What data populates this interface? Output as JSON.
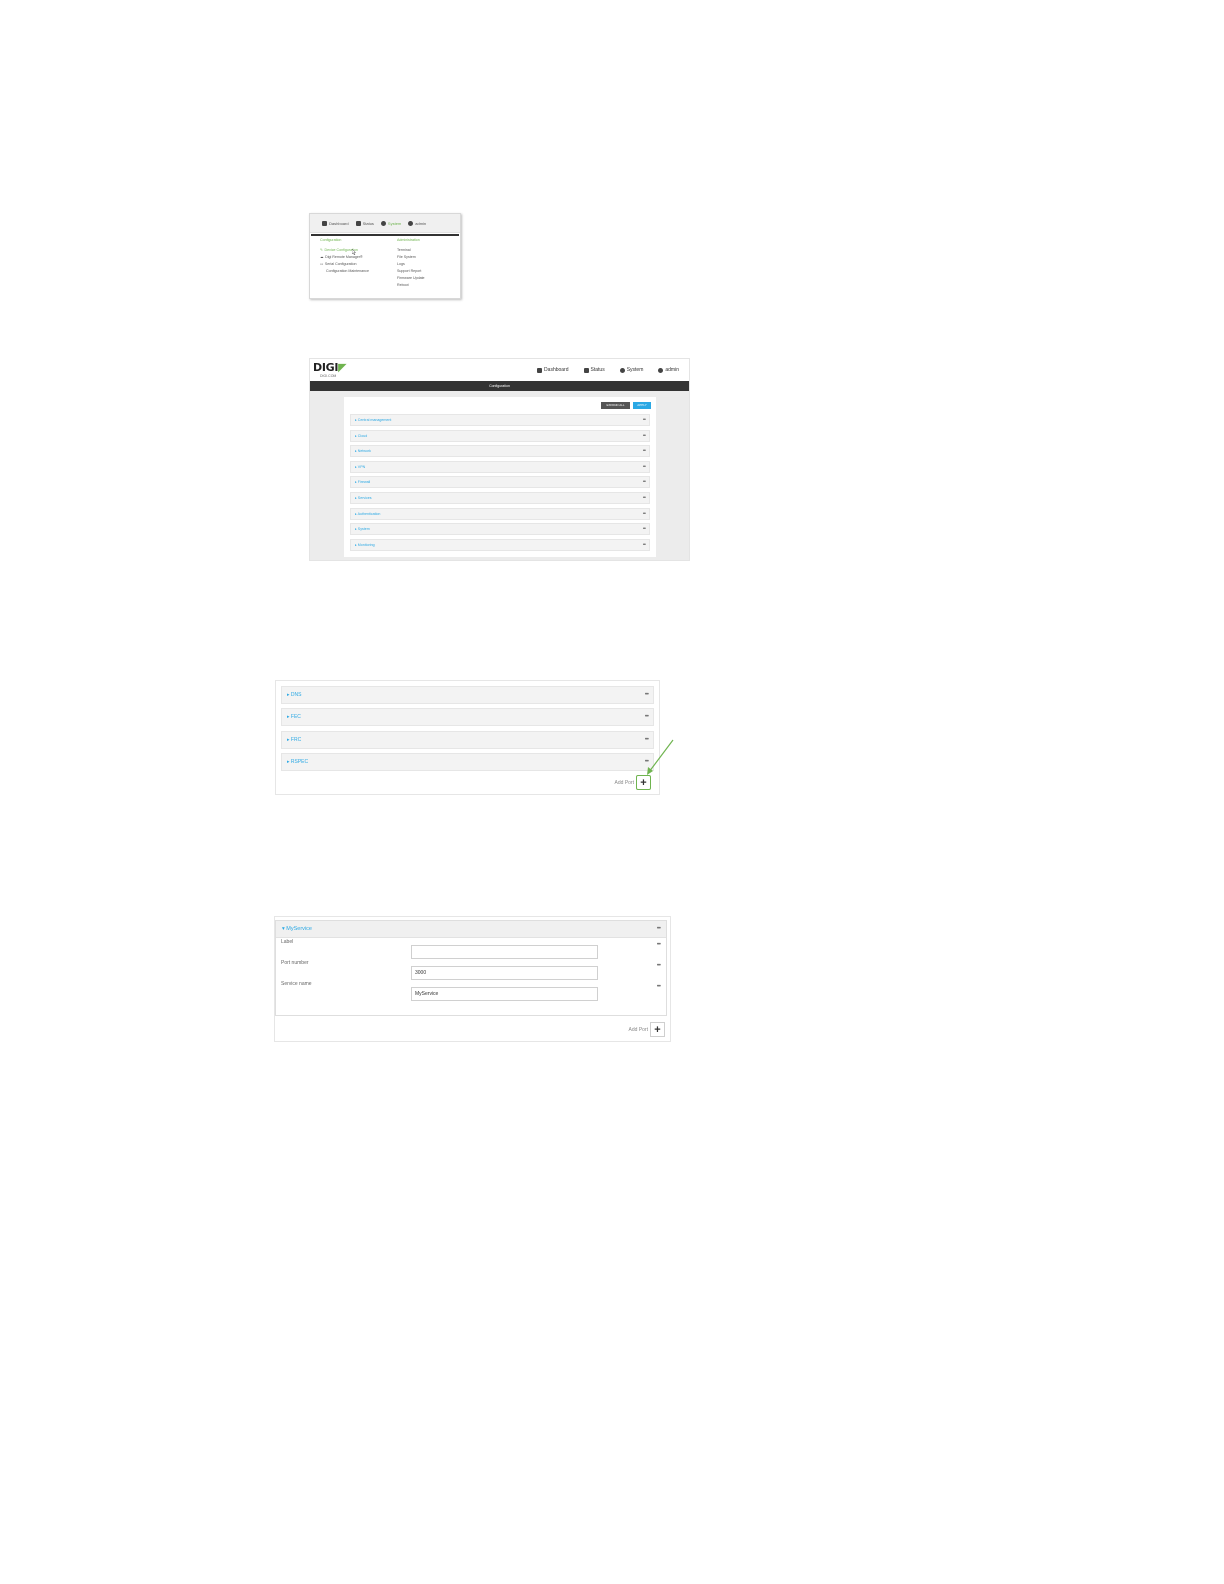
{
  "menu_shot": {
    "nav": [
      {
        "label": "Dashboard",
        "icon": "dashboard-icon"
      },
      {
        "label": "Status",
        "icon": "grid-icon"
      },
      {
        "label": "System",
        "icon": "gear-icon"
      },
      {
        "label": "admin",
        "icon": "user-icon"
      }
    ],
    "configuration_heading": "Configuration",
    "configuration_items": [
      "Device Configuration",
      "Digi Remote Manager®",
      "Serial Configuration",
      "Configuration Maintenance"
    ],
    "administration_heading": "Administration",
    "administration_items": [
      "Terminal",
      "File System",
      "Logs",
      "Support Report",
      "Firmware Update",
      "Reboot"
    ],
    "accent_color": "#6fb44f"
  },
  "config_shot": {
    "logo": "DIGI",
    "logo_sub": "DIGI.COM",
    "nav": [
      {
        "label": "Dashboard",
        "icon": "dashboard-icon"
      },
      {
        "label": "Status",
        "icon": "grid-icon"
      },
      {
        "label": "System",
        "icon": "gear-icon"
      },
      {
        "label": "admin",
        "icon": "user-icon"
      }
    ],
    "title_bar": "Configuration",
    "expand_all": "EXPAND ALL",
    "apply": "APPLY",
    "sections": [
      "Central management",
      "Cloud",
      "Network",
      "VPN",
      "Firewall",
      "Services",
      "Authentication",
      "System",
      "Monitoring"
    ],
    "apply_color": "#2aa8e4"
  },
  "ports_shot": {
    "rows": [
      "DNS",
      "FEC",
      "FRC",
      "RSPEC"
    ],
    "add_label": "Add Port"
  },
  "service_shot": {
    "service_name": "MyService",
    "fields": [
      {
        "label": "Label",
        "value": ""
      },
      {
        "label": "Port number",
        "value": "3000"
      },
      {
        "label": "Service name",
        "value": "MyService"
      }
    ],
    "add_label": "Add Port"
  }
}
